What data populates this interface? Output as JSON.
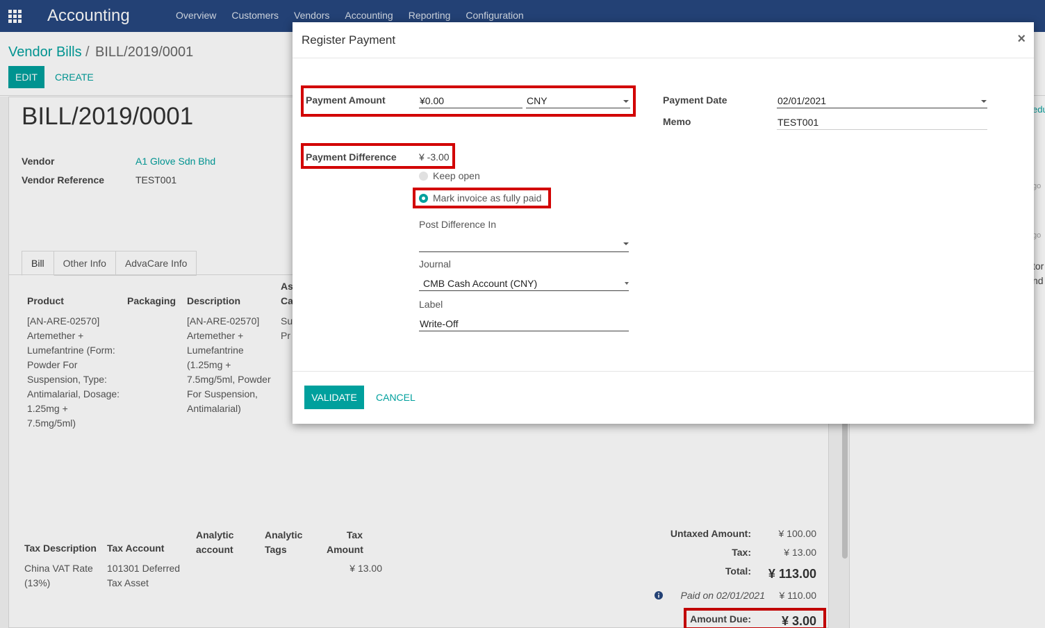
{
  "navbar": {
    "brand": "Accounting",
    "menu": [
      "Overview",
      "Customers",
      "Vendors",
      "Accounting",
      "Reporting",
      "Configuration"
    ]
  },
  "breadcrumb": {
    "parent": "Vendor Bills",
    "separator": "/",
    "current": "BILL/2019/0001"
  },
  "control": {
    "edit_label": "EDIT",
    "create_label": "CREATE"
  },
  "bill": {
    "number": "BILL/2019/0001",
    "vendor_label": "Vendor",
    "vendor_value": "A1 Glove Sdn Bhd",
    "vendor_ref_label": "Vendor Reference",
    "vendor_ref_value": "TEST001"
  },
  "tabs": [
    "Bill",
    "Other Info",
    "AdvaCare Info"
  ],
  "lines": {
    "headers": {
      "product": "Product",
      "packaging": "Packaging",
      "description": "Description",
      "as": "As",
      "ca": "Ca"
    },
    "row": {
      "product": [
        "[AN-ARE-02570]",
        "Artemether +",
        "Lumefantrine (Form:",
        "Powder For",
        "Suspension, Type:",
        "Antimalarial, Dosage:",
        "1.25mg +",
        "7.5mg/5ml)"
      ],
      "description": [
        "[AN-ARE-02570]",
        "Artemether +",
        "Lumefantrine",
        "(1.25mg +",
        "7.5mg/5ml, Powder",
        "For Suspension,",
        "Antimalarial)"
      ],
      "col4": [
        "Su",
        "Pr"
      ]
    }
  },
  "tax": {
    "headers": {
      "description": "Tax Description",
      "account": "Tax Account",
      "analytic_account": [
        "Analytic",
        "account"
      ],
      "analytic_tags": [
        "Analytic",
        "Tags"
      ],
      "tax_amount": [
        "Tax",
        "Amount"
      ]
    },
    "row": {
      "description": [
        "China VAT Rate",
        "(13%)"
      ],
      "account": [
        "101301 Deferred",
        "Tax Asset"
      ],
      "amount": "¥ 13.00"
    }
  },
  "totals": {
    "untaxed_label": "Untaxed Amount:",
    "untaxed_value": "¥ 100.00",
    "tax_label": "Tax:",
    "tax_value": "¥ 13.00",
    "total_label": "Total:",
    "total_value": "¥ 113.00",
    "paid_label": "Paid on 02/01/2021",
    "paid_value": "¥ 110.00",
    "due_label": "Amount Due:",
    "due_value": "¥ 3.00"
  },
  "right_panel_fragments": [
    "edu",
    "go",
    "go",
    "tor",
    "nd"
  ],
  "modal": {
    "title": "Register Payment",
    "close": "×",
    "payment_amount_label": "Payment Amount",
    "payment_amount_value": "¥0.00",
    "currency_value": "CNY",
    "payment_date_label": "Payment Date",
    "payment_date_value": "02/01/2021",
    "memo_label": "Memo",
    "memo_value": "TEST001",
    "payment_difference_label": "Payment Difference",
    "payment_difference_value": "¥ -3.00",
    "option_keep_open": "Keep open",
    "option_mark_paid": "Mark invoice as fully paid",
    "post_difference_label": "Post Difference In",
    "post_difference_value": "",
    "journal_label": "Journal",
    "journal_value": "CMB Cash Account (CNY)",
    "label_label": "Label",
    "label_value": "Write-Off",
    "validate_label": "VALIDATE",
    "cancel_label": "CANCEL"
  },
  "colors": {
    "navbar": "#26477f",
    "accent": "#00a09d",
    "highlight": "#d20000"
  }
}
